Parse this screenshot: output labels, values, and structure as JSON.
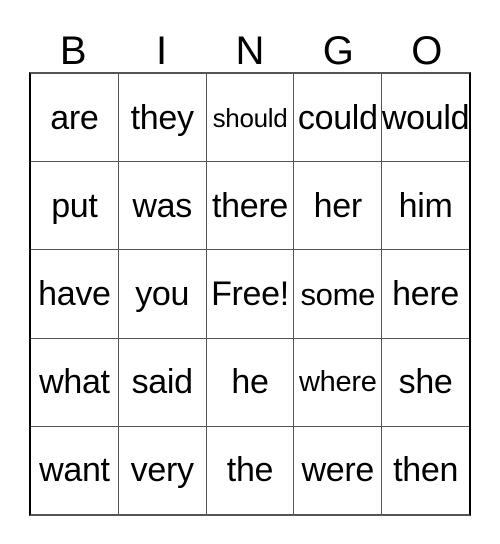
{
  "card": {
    "title": "BINGO",
    "header": [
      "B",
      "I",
      "N",
      "G",
      "O"
    ],
    "rows": [
      [
        {
          "word": "are",
          "size": "full"
        },
        {
          "word": "they",
          "size": "full"
        },
        {
          "word": "should",
          "size": "sm"
        },
        {
          "word": "could",
          "size": "full"
        },
        {
          "word": "would",
          "size": "full"
        }
      ],
      [
        {
          "word": "put",
          "size": "full"
        },
        {
          "word": "was",
          "size": "full"
        },
        {
          "word": "there",
          "size": "full"
        },
        {
          "word": "her",
          "size": "full"
        },
        {
          "word": "him",
          "size": "full"
        }
      ],
      [
        {
          "word": "have",
          "size": "full"
        },
        {
          "word": "you",
          "size": "full"
        },
        {
          "word": "Free!",
          "size": "full"
        },
        {
          "word": "some",
          "size": "lg"
        },
        {
          "word": "here",
          "size": "full"
        }
      ],
      [
        {
          "word": "what",
          "size": "full"
        },
        {
          "word": "said",
          "size": "full"
        },
        {
          "word": "he",
          "size": "full"
        },
        {
          "word": "where",
          "size": "md"
        },
        {
          "word": "she",
          "size": "full"
        }
      ],
      [
        {
          "word": "want",
          "size": "full"
        },
        {
          "word": "very",
          "size": "full"
        },
        {
          "word": "the",
          "size": "full"
        },
        {
          "word": "were",
          "size": "full"
        },
        {
          "word": "then",
          "size": "full"
        }
      ]
    ],
    "free_space": {
      "row": 2,
      "column": 2,
      "label": "Free!"
    },
    "colors": {
      "background": "#ffffff",
      "text": "#000000",
      "grid_line": "#555555",
      "grid_border": "#000000"
    }
  }
}
